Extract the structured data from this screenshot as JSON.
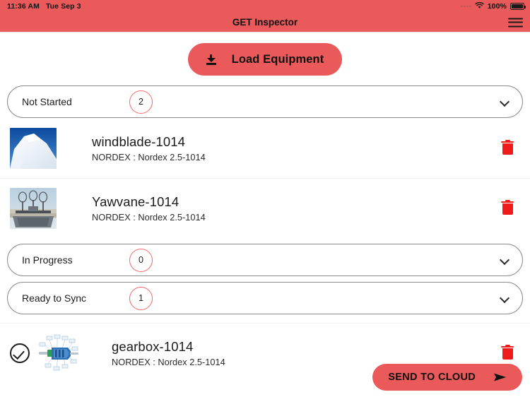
{
  "status_bar": {
    "time": "11:36 AM",
    "date": "Tue Sep 3",
    "battery_text": "100%",
    "wifi_icon": "wifi-icon",
    "battery_icon": "battery-full-icon",
    "signal_icon": "signal-dots-icon"
  },
  "app_bar": {
    "title": "GET Inspector",
    "menu_icon": "hamburger-menu-icon"
  },
  "toolbar": {
    "load_label": "Load Equipment",
    "load_icon": "download-icon"
  },
  "sections": [
    {
      "label": "Not Started",
      "count": "2",
      "chevron_icon": "chevron-down-icon",
      "expanded": true
    },
    {
      "label": "In Progress",
      "count": "0",
      "chevron_icon": "chevron-down-icon",
      "expanded": false
    },
    {
      "label": "Ready to Sync",
      "count": "1",
      "chevron_icon": "chevron-down-icon",
      "expanded": true
    }
  ],
  "not_started_items": [
    {
      "title": "windblade-1014",
      "subtitle": "NORDEX : Nordex 2.5-1014",
      "thumbnail": "windblade-photo",
      "delete_icon": "trash-icon"
    },
    {
      "title": "Yawvane-1014",
      "subtitle": "NORDEX : Nordex 2.5-1014",
      "thumbnail": "yawvane-photo",
      "delete_icon": "trash-icon"
    }
  ],
  "ready_to_sync_items": [
    {
      "title": "gearbox-1014",
      "subtitle": "NORDEX : Nordex 2.5-1014",
      "thumbnail": "gearbox-diagram",
      "status_icon": "check-circle-icon",
      "delete_icon": "trash-icon"
    }
  ],
  "footer": {
    "send_label": "SEND TO CLOUD",
    "send_icon": "send-arrow-icon"
  },
  "colors": {
    "accent": "#EA5A5A",
    "badge_outline": "#EC6B6B",
    "delete": "#F11A1A",
    "text": "#1B1B1B"
  }
}
